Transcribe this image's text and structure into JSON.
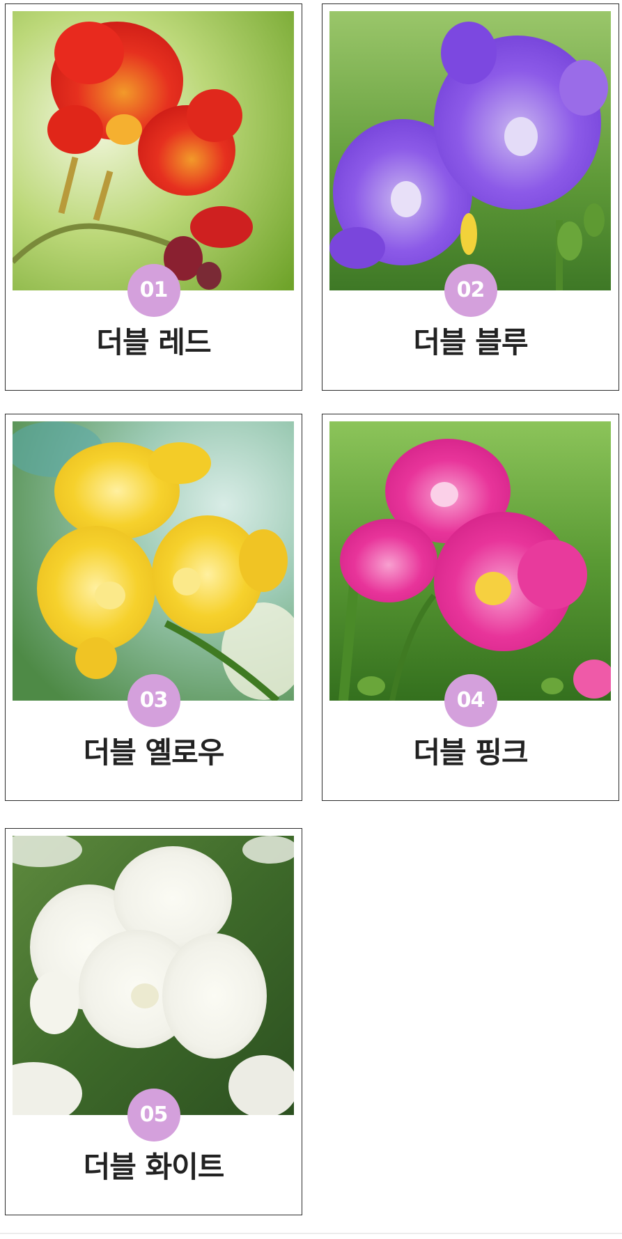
{
  "products": [
    {
      "number": "01",
      "name": "더블 레드",
      "photo": "red-double-freesia-photo",
      "color": "#e0261b"
    },
    {
      "number": "02",
      "name": "더블 블루",
      "photo": "blue-double-freesia-photo",
      "color": "#8a55e6"
    },
    {
      "number": "03",
      "name": "더블 옐로우",
      "photo": "yellow-double-freesia-photo",
      "color": "#f4cc2c"
    },
    {
      "number": "04",
      "name": "더블 핑크",
      "photo": "pink-double-freesia-photo",
      "color": "#e8349a"
    },
    {
      "number": "05",
      "name": "더블 화이트",
      "photo": "white-double-freesia-photo",
      "color": "#f7f7f2"
    }
  ],
  "colors": {
    "badge": "#d4a0dc",
    "border": "#2b2b2b",
    "label_text": "#222222"
  }
}
